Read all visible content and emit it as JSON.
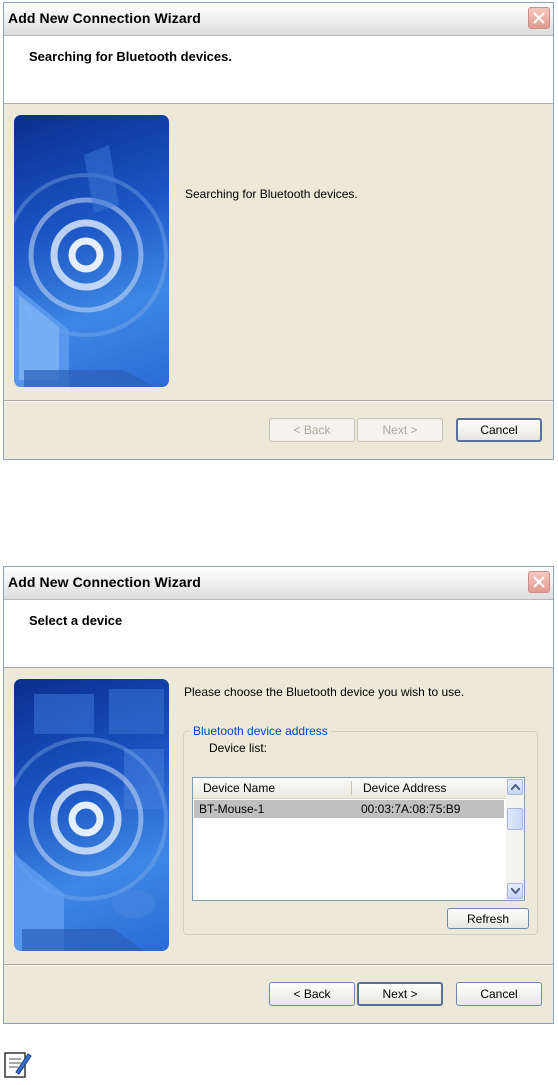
{
  "wizard1": {
    "title": "Add New Connection Wizard",
    "header": "Searching for Bluetooth devices.",
    "message": "Searching for Bluetooth devices.",
    "buttons": {
      "back": "< Back",
      "next": "Next >",
      "cancel": "Cancel"
    }
  },
  "wizard2": {
    "title": "Add New Connection Wizard",
    "header": "Select a device",
    "prompt": "Please choose the Bluetooth device you wish to use.",
    "group_label": "Bluetooth device address",
    "device_list_label": "Device list:",
    "columns": [
      "Device Name",
      "Device Address"
    ],
    "devices": [
      {
        "name": "BT-Mouse-1",
        "address": "00:03:7A:08:75:B9"
      }
    ],
    "refresh": "Refresh",
    "buttons": {
      "back": "< Back",
      "next": "Next >",
      "cancel": "Cancel"
    }
  },
  "icons": {
    "close": "close-icon",
    "note": "note-icon"
  },
  "colors": {
    "group_label": "#0046d5",
    "selection": "#c0c0c0"
  }
}
